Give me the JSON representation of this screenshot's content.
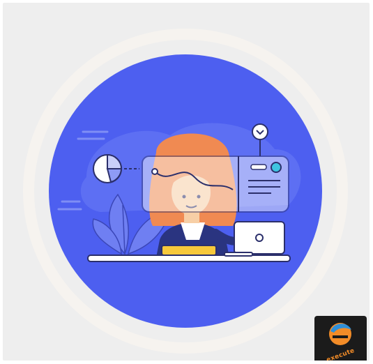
{
  "illustration": {
    "subject": "person-at-desk-with-laptop-and-dashboard-panel",
    "icons": [
      "pie-chart-icon",
      "leaf-plant-icon",
      "laptop-icon",
      "chevron-down-icon",
      "dashboard-panel-icon"
    ]
  },
  "badge": {
    "logo_text": "execute",
    "colors": {
      "background": "#1b1b1b",
      "orange": "#f28c28",
      "blue": "#2f8fd8"
    }
  },
  "colors": {
    "background": "#eeeeee",
    "circle": "#4d5ff0",
    "ring": "#ffffff",
    "hair": "#f08a52",
    "desk": "#ffffff",
    "keyboard": "#f7c83b",
    "panel": "#ffffff",
    "accent": "#3ec4e0"
  }
}
